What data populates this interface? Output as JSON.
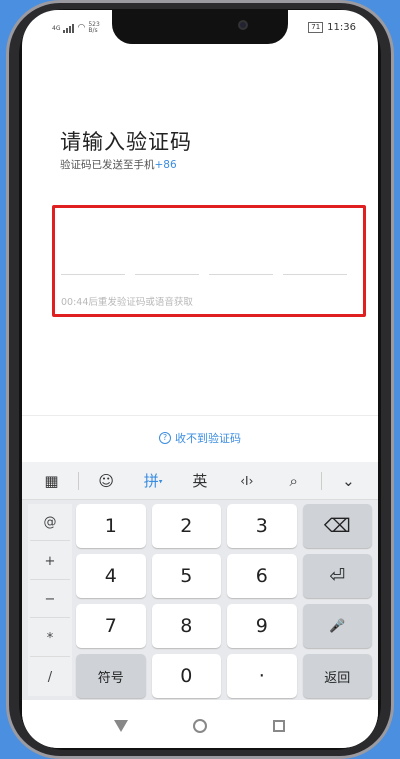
{
  "status": {
    "network": "4G",
    "speed": "523 B/s",
    "battery": "71",
    "time": "11:36"
  },
  "page": {
    "title": "请输入验证码",
    "subtitle_prefix": "验证码已发送至手机",
    "subtitle_code": "+86",
    "resend_text": "00:44后重发验证码或语音获取",
    "no_code_label": "收不到验证码"
  },
  "keyboard": {
    "toolbar": {
      "grid": "▦",
      "emoji": "☺",
      "pinyin": "拼",
      "english": "英",
      "cursor": "‹I›",
      "search": "⌕",
      "collapse": "⌄"
    },
    "side": [
      "@",
      "+",
      "−",
      "*",
      "/"
    ],
    "keys": {
      "k1": "1",
      "k2": "2",
      "k3": "3",
      "del": "⌫",
      "k4": "4",
      "k5": "5",
      "k6": "6",
      "enter": "⏎",
      "k7": "7",
      "k8": "8",
      "k9": "9",
      "mic": "🎤",
      "symbol": "符号",
      "k0": "0",
      "dot": "·",
      "back": "返回"
    }
  },
  "colors": {
    "accent": "#3b8de0",
    "highlight_box": "#e02020"
  }
}
